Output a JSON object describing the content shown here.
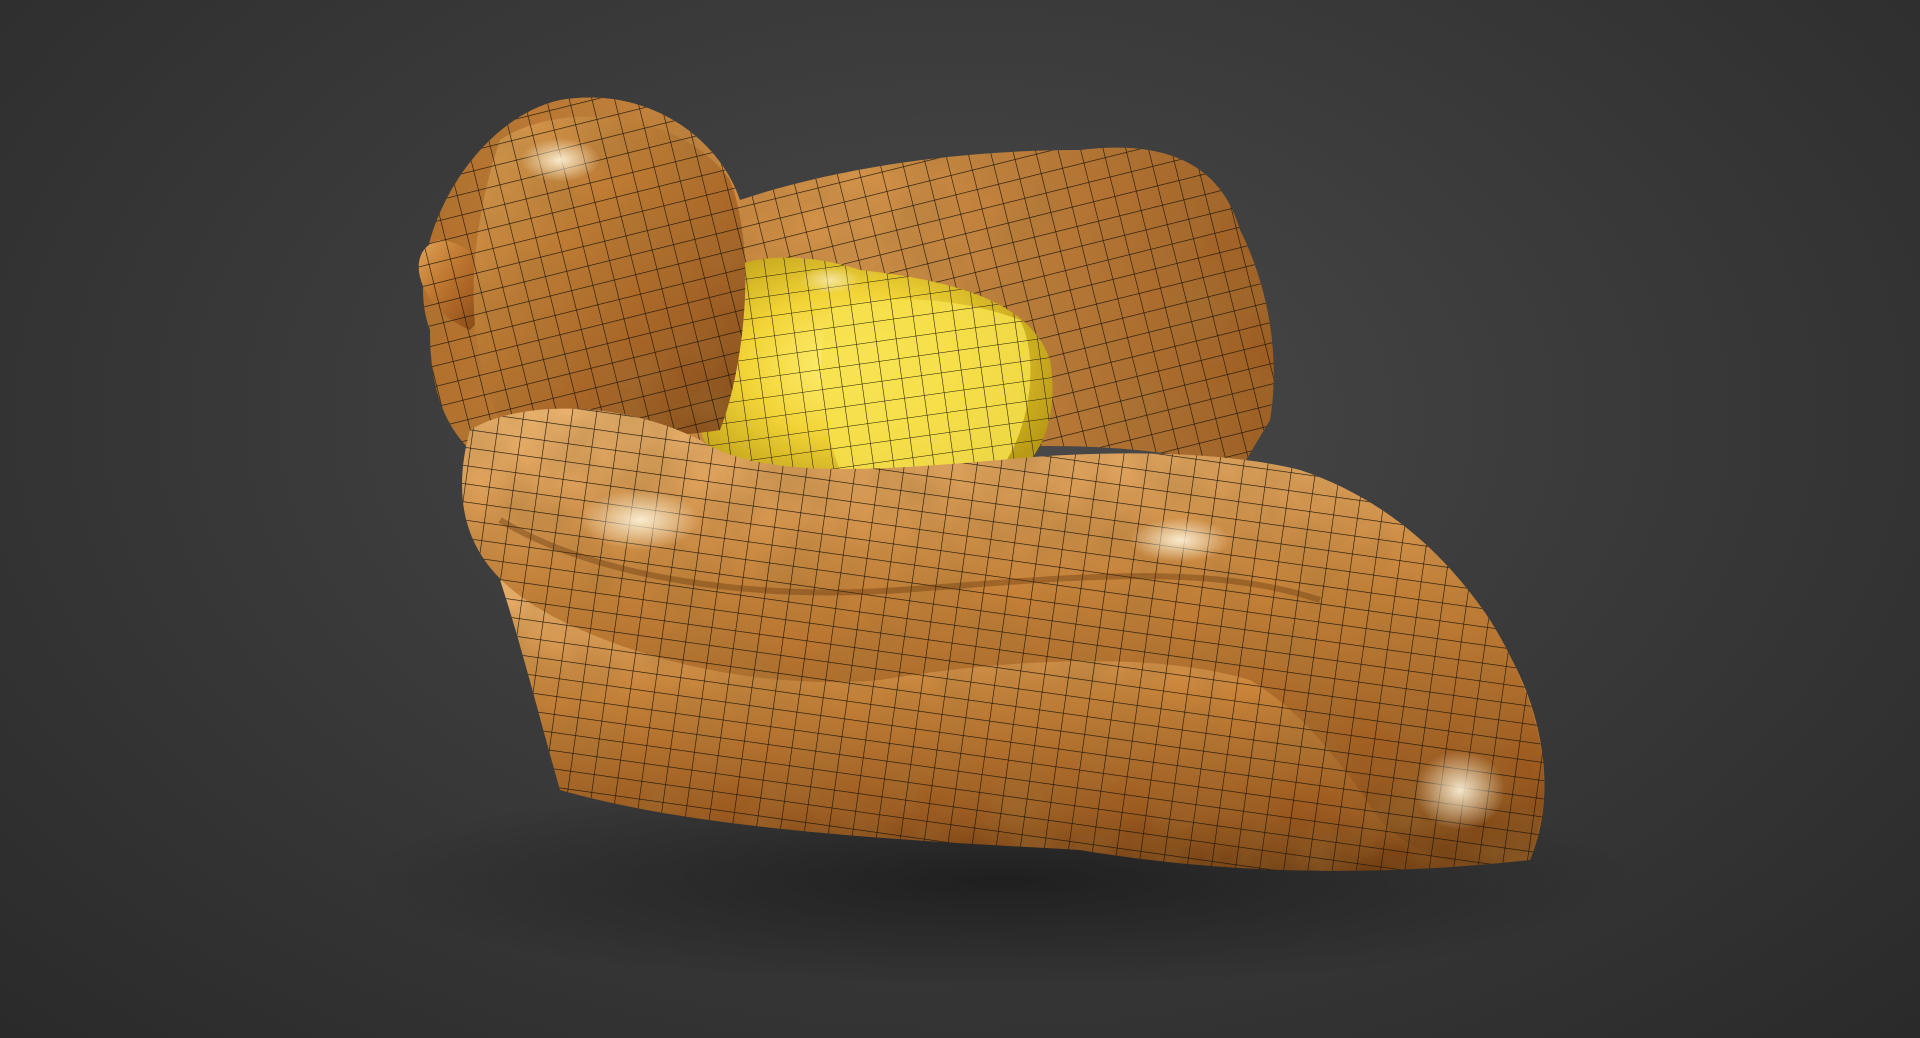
{
  "viewport": {
    "background_color": "#3a3a3a",
    "mode": "shaded-with-wireframe"
  },
  "model": {
    "description_icon": "cushion-mesh",
    "outer_color": "#c07a2e",
    "inner_color": "#f2d437",
    "wire_color": "#1b1307"
  }
}
